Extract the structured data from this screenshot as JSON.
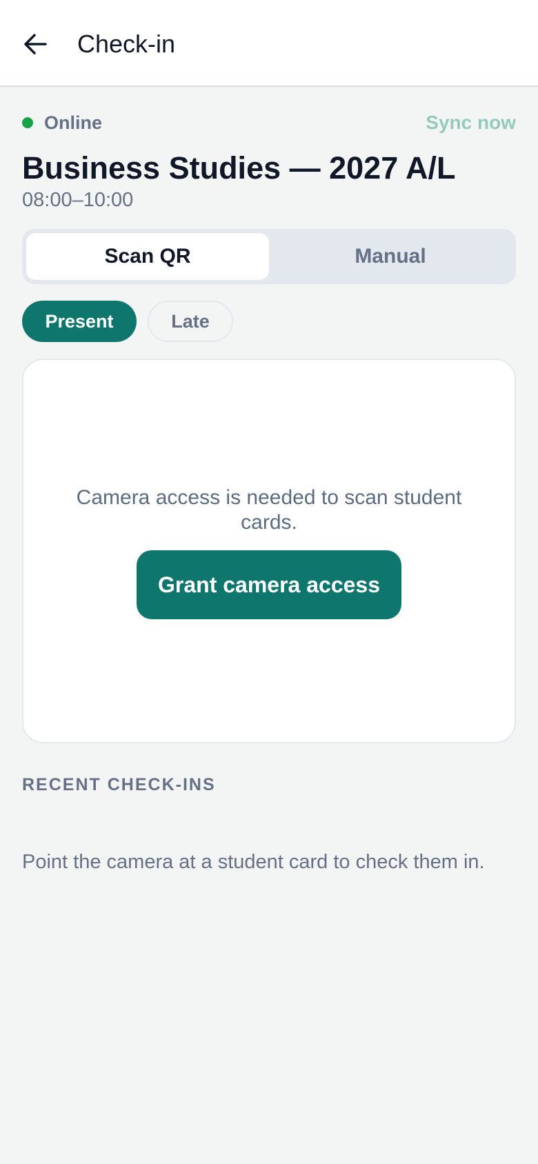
{
  "header": {
    "title": "Check-in",
    "back_icon": "arrow-left-icon"
  },
  "status": {
    "label": "Online",
    "dot_color": "#16a34a",
    "sync_label": "Sync now"
  },
  "session": {
    "title": "Business Studies — 2027 A/L",
    "time": "08:00–10:00"
  },
  "mode_tabs": [
    {
      "label": "Scan QR",
      "active": true
    },
    {
      "label": "Manual",
      "active": false
    }
  ],
  "status_chips": [
    {
      "label": "Present",
      "selected": true
    },
    {
      "label": "Late",
      "selected": false
    }
  ],
  "camera": {
    "message": "Camera access is needed to scan student cards.",
    "button_label": "Grant camera access"
  },
  "recent": {
    "header": "RECENT CHECK-INS",
    "empty_message": "Point the camera at a student card to check them in."
  },
  "colors": {
    "accent": "#0f766e",
    "background": "#f3f5f5",
    "muted_text": "#667085",
    "sync_text": "#96c9bd"
  }
}
